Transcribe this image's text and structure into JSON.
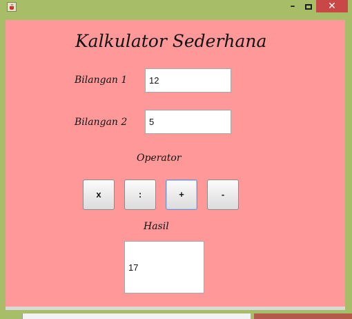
{
  "window": {
    "icon": "java-coffee-icon",
    "minimize_glyph": "–",
    "close_glyph": "✕"
  },
  "app": {
    "title": "Kalkulator Sederhana",
    "input1": {
      "label": "Bilangan 1",
      "value": "12"
    },
    "input2": {
      "label": "Bilangan 2",
      "value": "5"
    },
    "operator_label": "Operator",
    "operators": [
      "x",
      ":",
      "+",
      "-"
    ],
    "active_operator": "+",
    "result_label": "Hasil",
    "result_value": "17"
  },
  "colors": {
    "background": "#ff9999",
    "window_frame": "#a7bd68",
    "close_button": "#c84747"
  }
}
